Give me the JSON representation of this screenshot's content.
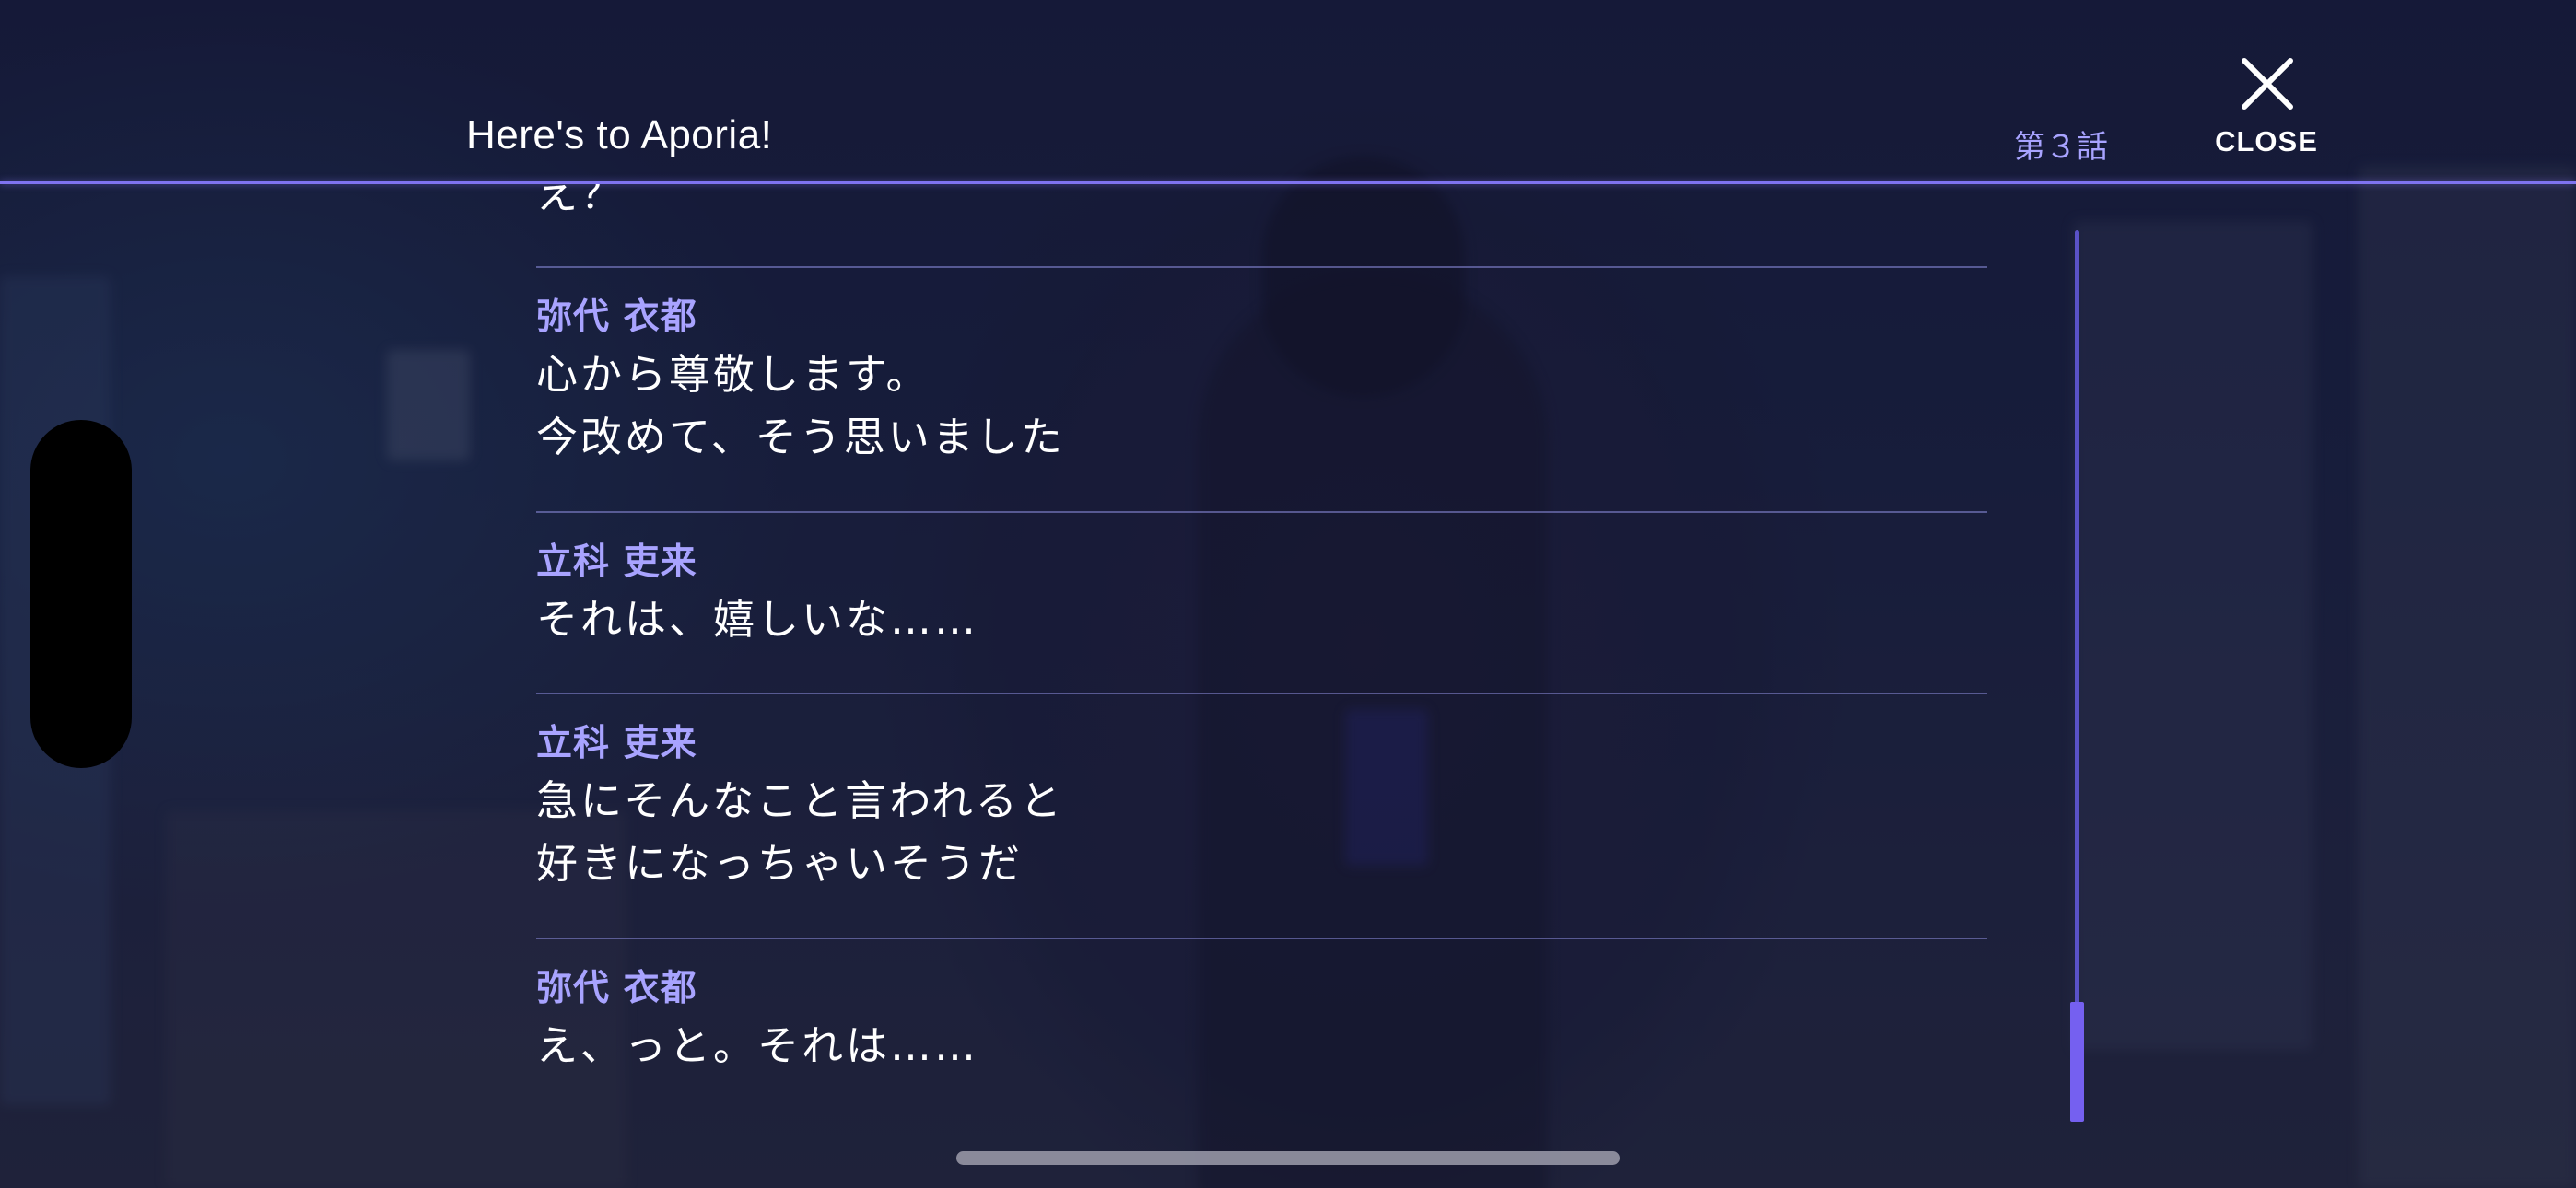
{
  "header": {
    "title": "Here's to Aporia!",
    "episode": "第３話",
    "close_label": "CLOSE"
  },
  "log": {
    "partial_line": "え？",
    "entries": [
      {
        "speaker": "弥代 衣都",
        "lines": [
          "心から尊敬します。",
          "今改めて、そう思いました"
        ]
      },
      {
        "speaker": "立科 吏来",
        "lines": [
          "それは、嬉しいな……"
        ]
      },
      {
        "speaker": "立科 吏来",
        "lines": [
          "急にそんなこと言われると",
          "好きになっちゃいそうだ"
        ]
      },
      {
        "speaker": "弥代 衣都",
        "lines": [
          "え、っと。それは……"
        ]
      }
    ]
  },
  "scroll": {
    "position_fraction": 1.0
  },
  "colors": {
    "accent": "#7f73f0",
    "speaker": "#a8a3ff",
    "text": "#ffffff"
  },
  "icons": {
    "close": "close-icon"
  }
}
